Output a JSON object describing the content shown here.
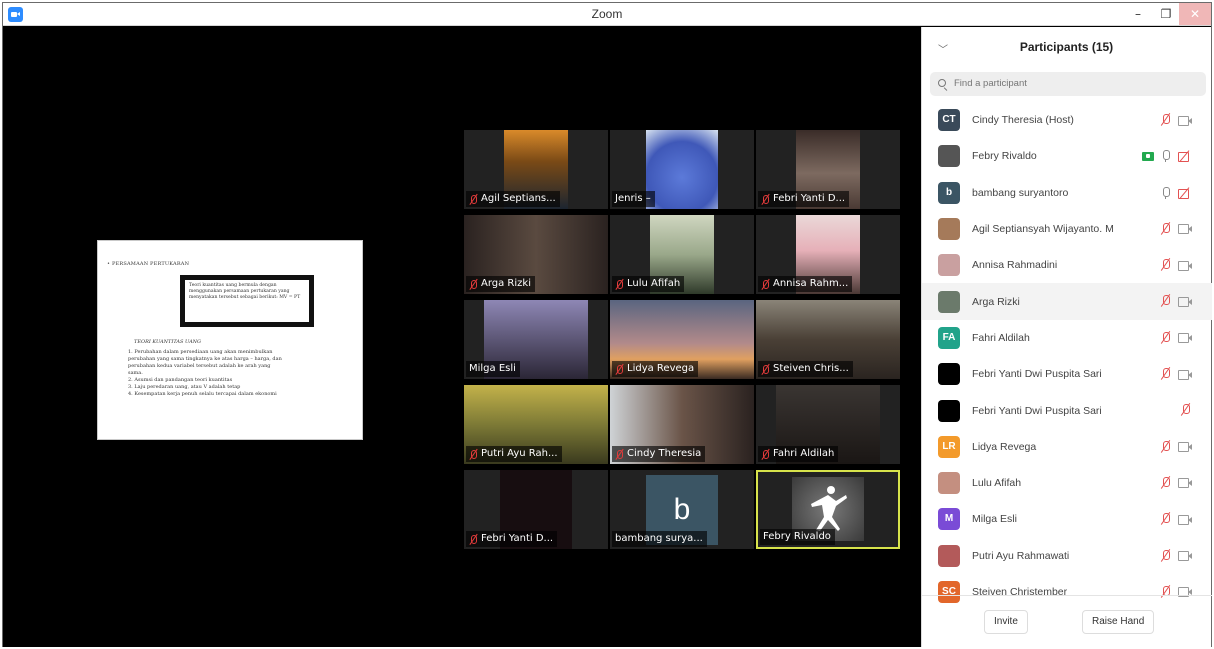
{
  "window": {
    "title": "Zoom"
  },
  "shared_screen": {
    "heading": "• PERSAMAAN PERTUKARAN",
    "box_text": "Teori kuantitas uang bermula dengan menggunakan persamaan pertukaran yang menyatakan tersebut sebagai berikut: MV = PT",
    "subheading": "TEORI KUANTITAS UANG",
    "points": [
      "1. Perubahan dalam persediaan uang akan menimbulkan perubahan yang sama tingkatnya ke atas harga – harga, dan perubahan kedua variabel tersebut adalah ke arah yang sama.",
      "2. Asumsi dan pandangan teori kuantitas",
      "3. Laju peredaran uang, atau V adalah tetap",
      "4. Kesempatan kerja penuh selalu tercapai dalam ekonomi"
    ]
  },
  "video_tiles": [
    {
      "name": "Agil Septians...",
      "muted": true
    },
    {
      "name": "Jenris –",
      "muted": false
    },
    {
      "name": "Febri Yanti D...",
      "muted": true
    },
    {
      "name": "Arga Rizki",
      "muted": true
    },
    {
      "name": "Lulu Afifah",
      "muted": true
    },
    {
      "name": "Annisa Rahm...",
      "muted": true
    },
    {
      "name": "Milga Esli",
      "muted": false
    },
    {
      "name": "Lidya Revega",
      "muted": true
    },
    {
      "name": "Steiven Chris...",
      "muted": true
    },
    {
      "name": "Putri Ayu Rah...",
      "muted": true
    },
    {
      "name": "Cindy Theresia",
      "muted": true
    },
    {
      "name": "Fahri Aldilah",
      "muted": true
    },
    {
      "name": "Febri Yanti D...",
      "muted": true
    },
    {
      "name": "bambang surya...",
      "muted": false,
      "letter": "b"
    },
    {
      "name": "Febry Rivaldo",
      "muted": false
    }
  ],
  "participants_panel": {
    "title": "Participants (15)",
    "search_placeholder": "Find a participant",
    "participants": [
      {
        "name": "Cindy Theresia (Host)",
        "avatar_text": "CT",
        "avatar_color": "#3a4a5a"
      },
      {
        "name": "Febry Rivaldo",
        "avatar_text": "",
        "avatar_color": "#555555"
      },
      {
        "name": "bambang suryantoro",
        "avatar_text": "b",
        "avatar_color": "#3b5564"
      },
      {
        "name": "Agil Septiansyah Wijayanto. M",
        "avatar_text": "",
        "avatar_color": "#a57a5a"
      },
      {
        "name": "Annisa Rahmadini",
        "avatar_text": "",
        "avatar_color": "#c9a0a0"
      },
      {
        "name": "Arga Rizki",
        "avatar_text": "",
        "avatar_color": "#6b7a6b"
      },
      {
        "name": "Fahri Aldilah",
        "avatar_text": "FA",
        "avatar_color": "#21a38a"
      },
      {
        "name": "Febri Yanti Dwi Puspita Sari",
        "avatar_text": "",
        "avatar_color": "#000000"
      },
      {
        "name": "Febri Yanti Dwi Puspita Sari",
        "avatar_text": "",
        "avatar_color": "#000000"
      },
      {
        "name": "Lidya Revega",
        "avatar_text": "LR",
        "avatar_color": "#f39a2b"
      },
      {
        "name": "Lulu Afifah",
        "avatar_text": "",
        "avatar_color": "#c48f80"
      },
      {
        "name": "Milga Esli",
        "avatar_text": "M",
        "avatar_color": "#7a4bd6"
      },
      {
        "name": "Putri Ayu Rahmawati",
        "avatar_text": "",
        "avatar_color": "#b35a5a"
      },
      {
        "name": "Steiven Christember",
        "avatar_text": "SC",
        "avatar_color": "#e2662a"
      }
    ],
    "invite_label": "Invite",
    "raise_hand_label": "Raise Hand"
  }
}
